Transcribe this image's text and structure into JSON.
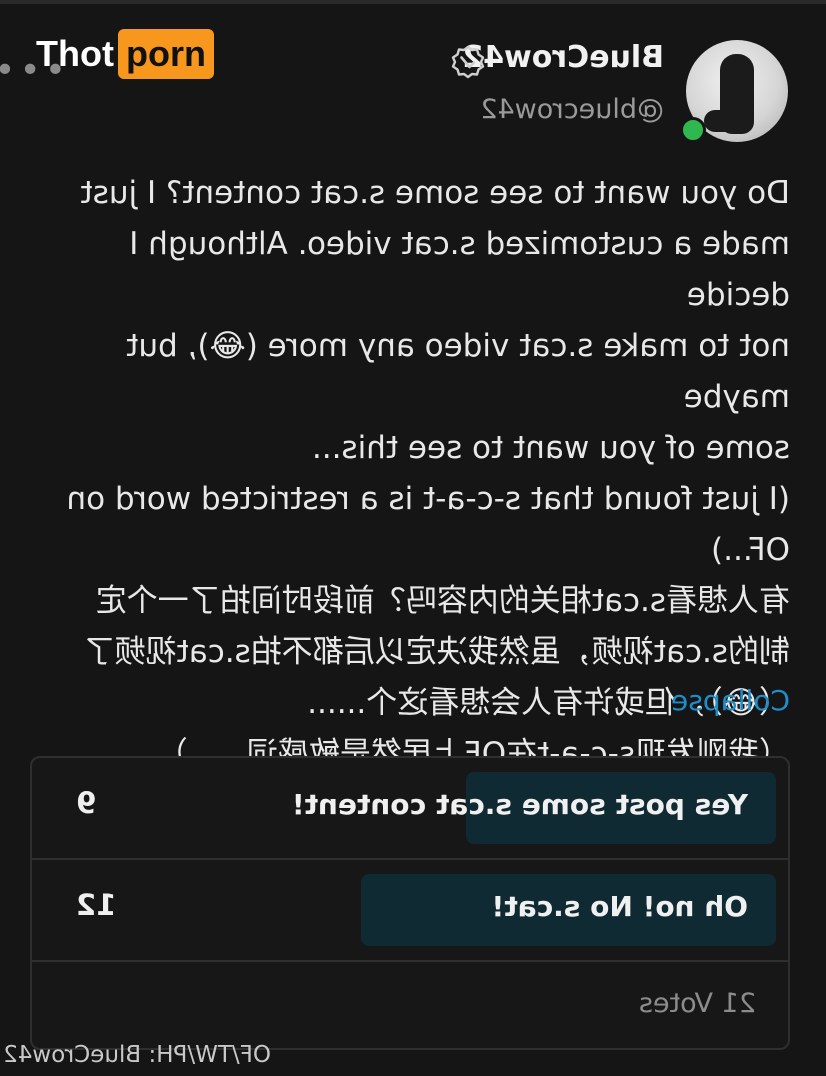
{
  "profile": {
    "display_name": "BlueCrow42",
    "handle": "@bluecrow42",
    "verified_icon": "verified-badge-icon",
    "online_status_color": "#2fb84f"
  },
  "post": {
    "text": "Do you want to see some s.cat content? I just\nmade a customized s.cat video. Although I decide\nnot to make s.cat video any more (😂), but maybe\nsome of you want to see this...\n(I just found that s-c-a-t is a restricted word on\nOF...)\n有人想看s.cat相关的内容吗？前段时间拍了一个定\n制的s.cat视频，虽然我决定以后都不拍s.cat视频了\n（😂），但或许有人会想看这个......\n（我刚发现s-c-a-t在OF上居然是敏感词......）",
    "collapse_label": "Collapse"
  },
  "poll": {
    "options": [
      {
        "label": "Yes post some s.cat content!",
        "votes": "9"
      },
      {
        "label": "Oh no! No s.cat!",
        "votes": "12"
      }
    ],
    "total_label": "21 Votes"
  },
  "footer_text": "OF/TW/PH: BlueCrow42",
  "watermark": {
    "part1": "Thot",
    "part2": "porn",
    "accent": "#f7971d"
  },
  "colors": {
    "link": "#1d8ec8",
    "poll_bar": "#0f2a33",
    "background": "#151515"
  }
}
